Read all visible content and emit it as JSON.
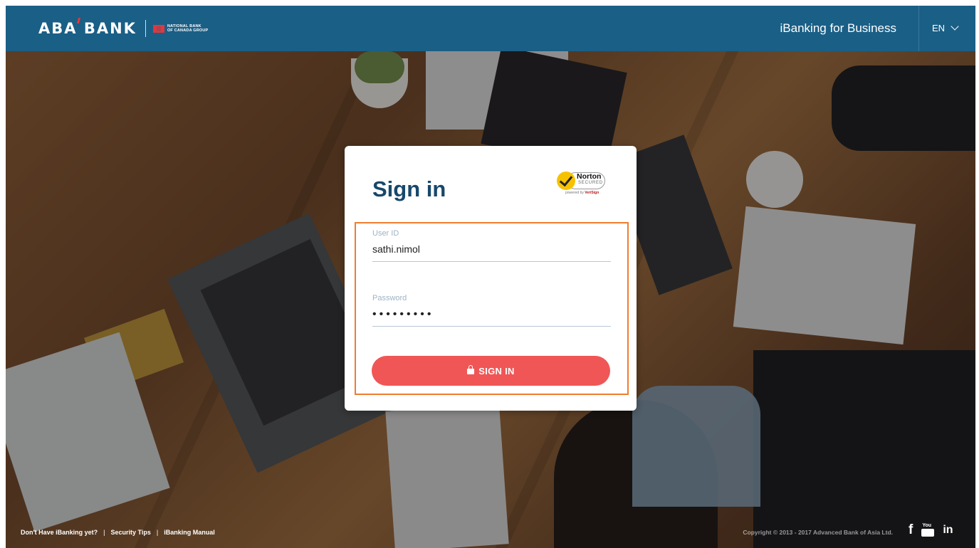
{
  "header": {
    "brand": "ABA BANK",
    "partner_line1": "NATIONAL BANK",
    "partner_line2": "OF CANADA GROUP",
    "title": "iBanking for Business",
    "language": "EN"
  },
  "signin": {
    "title": "Sign in",
    "norton": {
      "name": "Norton",
      "secured": "SECURED",
      "powered_by": "powered by",
      "vendor": "VeriSign"
    },
    "user_id": {
      "label": "User ID",
      "value": "sathi.nimol"
    },
    "password": {
      "label": "Password",
      "value": "•••••••••"
    },
    "button_label": "SIGN IN"
  },
  "footer": {
    "links": [
      "Don't Have iBanking yet?",
      "Security Tips",
      "iBanking Manual"
    ],
    "separator": "|",
    "copyright": "Copyright © 2013 - 2017 Advanced Bank of Asia Ltd."
  },
  "social": {
    "facebook": "f",
    "youtube_top": "You",
    "youtube_bottom": "Tube",
    "linkedin": "in"
  },
  "colors": {
    "header": "#1a5f86",
    "title": "#17486b",
    "button": "#f05656",
    "highlight": "#f07d2e"
  }
}
